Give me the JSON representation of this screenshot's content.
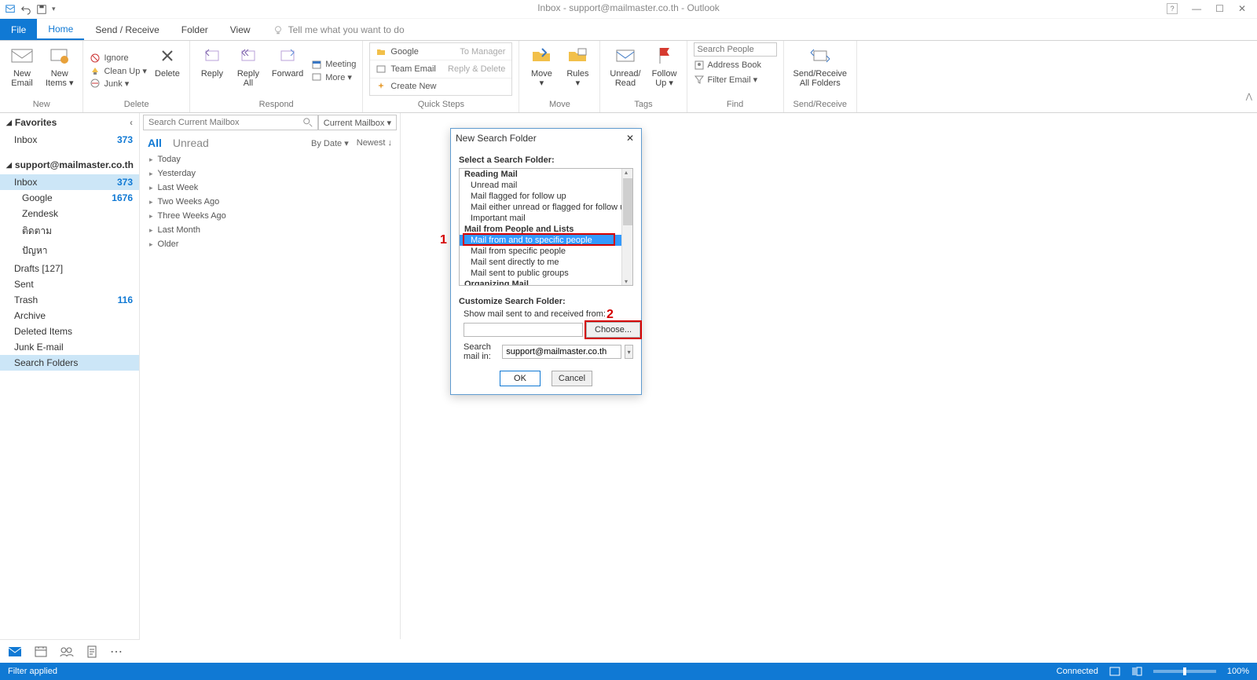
{
  "window": {
    "title": "Inbox - support@mailmaster.co.th - Outlook",
    "buttons": {
      "min": "—",
      "max": "☐",
      "close": "✕"
    }
  },
  "tabs": {
    "file": "File",
    "home": "Home",
    "sr": "Send / Receive",
    "folder": "Folder",
    "view": "View",
    "tellme": "Tell me what you want to do"
  },
  "ribbon": {
    "new": {
      "email": "New\nEmail",
      "items": "New\nItems ▾",
      "group": "New"
    },
    "delete": {
      "ignore": "Ignore",
      "cleanup": "Clean Up ▾",
      "junk": "Junk ▾",
      "delete": "Delete",
      "group": "Delete"
    },
    "respond": {
      "reply": "Reply",
      "replyall": "Reply\nAll",
      "forward": "Forward",
      "meeting": "Meeting",
      "more": "More ▾",
      "group": "Respond"
    },
    "quicksteps": {
      "google": "Google",
      "team": "Team Email",
      "create": "Create New",
      "mgr": "To Manager",
      "rd": "Reply & Delete",
      "group": "Quick Steps"
    },
    "move": {
      "move": "Move\n▾",
      "rules": "Rules\n▾",
      "group": "Move"
    },
    "tags": {
      "unread": "Unread/\nRead",
      "follow": "Follow\nUp ▾",
      "group": "Tags"
    },
    "find": {
      "placeholder": "Search People",
      "ab": "Address Book",
      "filter": "Filter Email ▾",
      "group": "Find"
    },
    "sr": {
      "label": "Send/Receive\nAll Folders",
      "group": "Send/Receive"
    }
  },
  "nav": {
    "favorites": "Favorites",
    "inbox": "Inbox",
    "inbox_count": "373",
    "account": "support@mailmaster.co.th",
    "folders": [
      {
        "label": "Inbox",
        "count": "373",
        "sel": true,
        "indent": 0
      },
      {
        "label": "Google",
        "count": "1676",
        "indent": 1
      },
      {
        "label": "Zendesk",
        "indent": 1
      },
      {
        "label": "ติดตาม",
        "indent": 1
      },
      {
        "label": "ปัญหา",
        "indent": 1
      },
      {
        "label": "Drafts [127]",
        "indent": 0
      },
      {
        "label": "Sent",
        "indent": 0
      },
      {
        "label": "Trash",
        "count": "116",
        "indent": 0
      },
      {
        "label": "Archive",
        "indent": 0
      },
      {
        "label": "Deleted Items",
        "indent": 0
      },
      {
        "label": "Junk E-mail",
        "indent": 0
      },
      {
        "label": "Search Folders",
        "indent": 0,
        "sel2": true
      }
    ]
  },
  "list": {
    "search_ph": "Search Current Mailbox",
    "scope": "Current Mailbox ▾",
    "all": "All",
    "unread": "Unread",
    "bydate": "By Date ▾",
    "newest": "Newest ↓",
    "groups": [
      "Today",
      "Yesterday",
      "Last Week",
      "Two Weeks Ago",
      "Three Weeks Ago",
      "Last Month",
      "Older"
    ]
  },
  "dialog": {
    "title": "New Search Folder",
    "select_lbl": "Select a Search Folder:",
    "cats": {
      "reading": "Reading Mail",
      "people": "Mail from People and Lists",
      "org": "Organizing Mail"
    },
    "opts": {
      "unread": "Unread mail",
      "flagged": "Mail flagged for follow up",
      "either": "Mail either unread or flagged for follow up",
      "important": "Important mail",
      "fromto": "Mail from and to specific people",
      "from": "Mail from specific people",
      "direct": "Mail sent directly to me",
      "public": "Mail sent to public groups"
    },
    "customize": "Customize Search Folder:",
    "show": "Show mail sent to and received from:",
    "choose": "Choose...",
    "searchin_lbl": "Search mail in:",
    "searchin_val": "support@mailmaster.co.th",
    "ok": "OK",
    "cancel": "Cancel",
    "ann1": "1",
    "ann2": "2"
  },
  "status": {
    "left": "Filter applied",
    "connected": "Connected",
    "zoom": "100%"
  }
}
